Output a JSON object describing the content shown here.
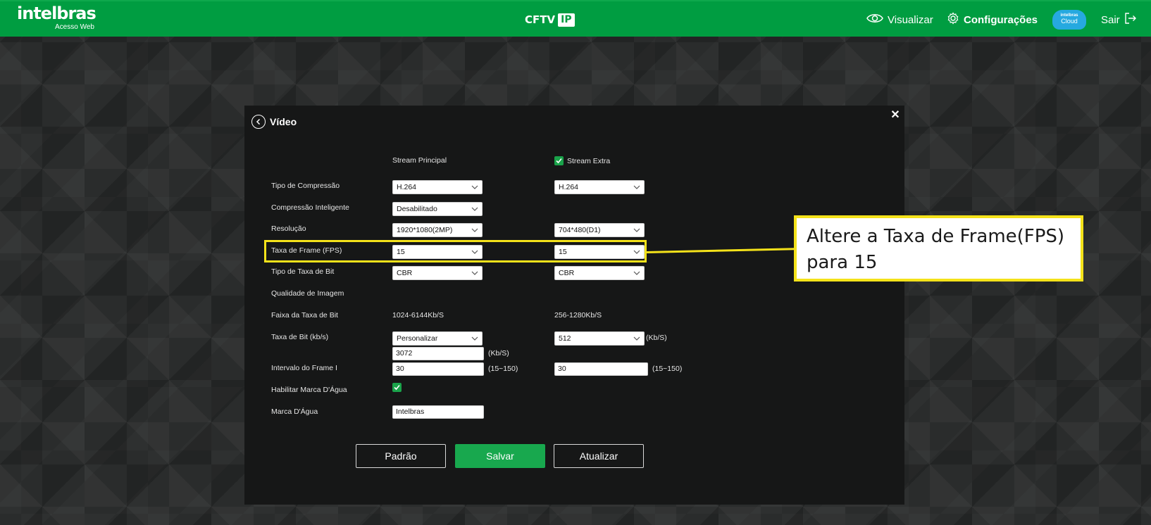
{
  "header": {
    "logo": "intelbras",
    "logo_sub": "Acesso Web",
    "brand": "CFTV",
    "brand_badge": "IP",
    "nav": {
      "visualizar": "Visualizar",
      "configuracoes": "Configurações",
      "cloud_top": "intelbras",
      "cloud_bottom": "Cloud",
      "sair": "Sair"
    }
  },
  "modal": {
    "title": "Vídeo",
    "col_main": "Stream Principal",
    "col_extra": "Stream Extra",
    "labels": {
      "compressao": "Tipo de Compressão",
      "compressao_inteligente": "Compressão Inteligente",
      "resolucao": "Resolução",
      "fps": "Taxa de Frame (FPS)",
      "tipo_bit": "Tipo de Taxa de Bit",
      "qualidade": "Qualidade de Imagem",
      "faixa": "Faixa da Taxa de Bit",
      "taxa_bit": "Taxa de Bit (kb/s)",
      "intervalo": "Intervalo do Frame I",
      "habilitar_marca": "Habilitar Marca D'Água",
      "marca": "Marca D'Água"
    },
    "main": {
      "compressao": "H.264",
      "compressao_inteligente": "Desabilitado",
      "resolucao": "1920*1080(2MP)",
      "fps": "15",
      "tipo_bit": "CBR",
      "faixa": "1024-6144Kb/S",
      "taxa_bit": "Personalizar",
      "taxa_bit_custom": "3072",
      "taxa_bit_unit": "(Kb/S)",
      "intervalo": "30",
      "intervalo_range": "(15~150)",
      "marca": "Intelbras"
    },
    "extra": {
      "compressao": "H.264",
      "resolucao": "704*480(D1)",
      "fps": "15",
      "tipo_bit": "CBR",
      "faixa": "256-1280Kb/S",
      "taxa_bit": "512",
      "taxa_bit_unit": "(Kb/S)",
      "intervalo": "30",
      "intervalo_range": "(15~150)"
    },
    "buttons": {
      "padrao": "Padrão",
      "salvar": "Salvar",
      "atualizar": "Atualizar"
    }
  },
  "annotation": {
    "text_line1": "Altere a Taxa de Frame(FPS)",
    "text_line2": "para 15"
  },
  "colors": {
    "brand_green": "#009d41",
    "button_green": "#18a84e",
    "highlight_yellow": "#f4e21a"
  }
}
